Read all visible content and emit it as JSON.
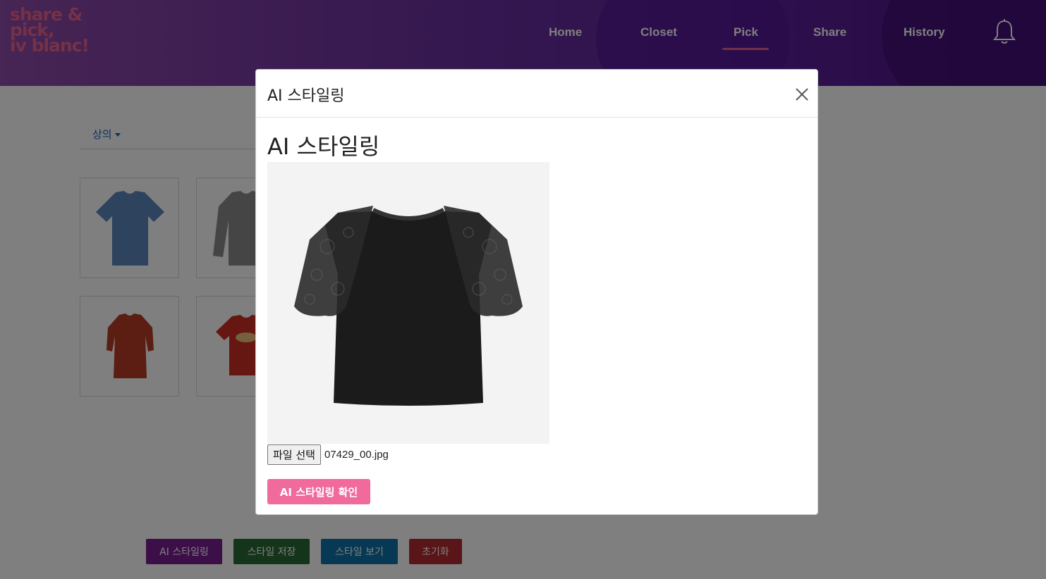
{
  "app": {
    "logo_lines": [
      "share &",
      "pick,",
      "iv blanc!"
    ]
  },
  "nav": {
    "items": [
      {
        "label": "Home"
      },
      {
        "label": "Closet"
      },
      {
        "label": "Pick",
        "active": true
      },
      {
        "label": "Share"
      },
      {
        "label": "History"
      }
    ],
    "icons": {
      "notifications": "bell-icon"
    }
  },
  "closet": {
    "category_label": "상의",
    "items": [
      {
        "name": "blue t-shirt",
        "color": "#5d86bd"
      },
      {
        "name": "grey sweatshirt",
        "color": "#8a8a8a"
      },
      {
        "name": "red fitted tee",
        "color": "#b83a24"
      },
      {
        "name": "red graphic tee",
        "color": "#cf2e22"
      }
    ]
  },
  "actions": {
    "ai_styling": "AI 스타일링",
    "save_style": "스타일 저장",
    "view_style": "스타일 보기",
    "reset": "초기화"
  },
  "colors": {
    "accent": "#f06b9c",
    "ai_styling_btn": "#7a1f92",
    "save_btn": "#2b6a36",
    "view_btn": "#0f73a8",
    "reset_btn": "#b22b2f"
  },
  "modal": {
    "title": "AI 스타일링",
    "heading": "AI 스타일링",
    "file_button": "파일 선택",
    "file_name": "07429_00.jpg",
    "confirm_button": "AI 스타일링 확인"
  }
}
